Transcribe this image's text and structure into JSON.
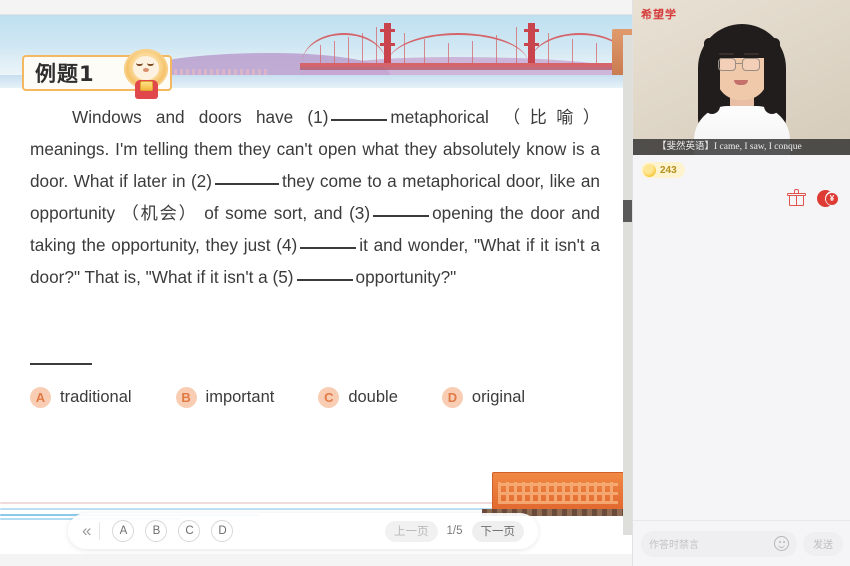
{
  "courseware": {
    "example_badge": "例题1",
    "mascot_icon": "monkey-mascot-icon",
    "passage": {
      "line1_pre": "Windows and doors have (1)",
      "line1_post": "metaphorical （比喻） meanings. I'm telling them they can't open what they absolutely know is a door. What if later in (2)",
      "line2_post": "they come to a metaphorical door, like an opportunity （机会） of some sort, and (3)",
      "line3_post": "opening the door and taking the opportunity, they just (4)",
      "line4_post": "it and wonder, \"What if it isn't a door?\" That is, \"What if it isn't a (5)",
      "line5_post": "opportunity?\""
    },
    "question_number_rule": "",
    "options": [
      {
        "letter": "A",
        "text": "traditional"
      },
      {
        "letter": "B",
        "text": "important"
      },
      {
        "letter": "C",
        "text": "double"
      },
      {
        "letter": "D",
        "text": "original"
      }
    ],
    "toolbar": {
      "collapse_icon": "«",
      "answer_chips": [
        "A",
        "B",
        "C",
        "D"
      ],
      "prev_page": "上一页",
      "page_indicator": "1/5",
      "next_page": "下一页"
    },
    "colors": {
      "badge_border": "#f4b860",
      "option_dot_bg": "#f9cdb4",
      "option_dot_text": "#e07a45",
      "bridge_red": "#c9444c",
      "building_orange": "#e2682f"
    }
  },
  "side_panel": {
    "video": {
      "brand_logo": "希望学",
      "caption": "【斐然英语】I came, I saw, I conque"
    },
    "coin": {
      "icon": "gold-coin-icon",
      "count": "243"
    },
    "action_icons": [
      {
        "name": "gift-box-icon"
      },
      {
        "name": "red-envelope-icon",
        "symbol": "¥"
      }
    ],
    "chat": {
      "placeholder": "作答时禁言",
      "emoji_icon": "smiley-icon",
      "send_label": "发送"
    }
  }
}
